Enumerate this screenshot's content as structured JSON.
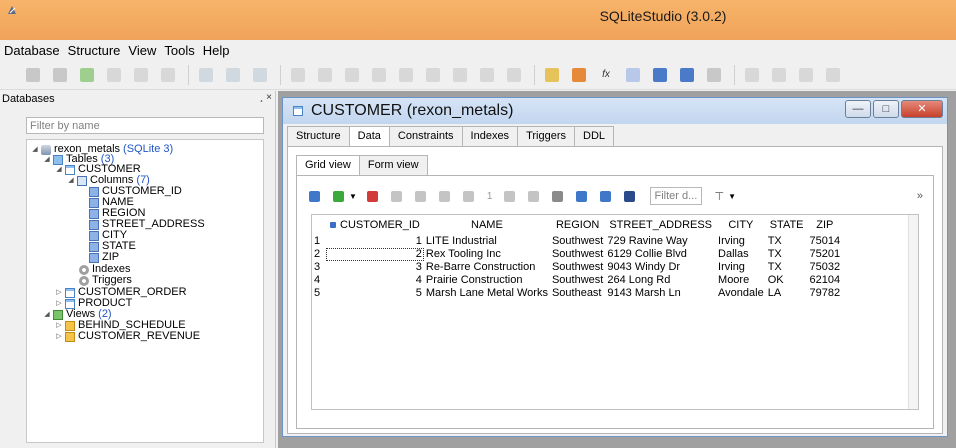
{
  "window": {
    "title": "SQLiteStudio (3.0.2)"
  },
  "menu": [
    "Database",
    "Structure",
    "View",
    "Tools",
    "Help"
  ],
  "dock": {
    "title": "Databases",
    "controls": "¸ ×",
    "filter_placeholder": "Filter by name"
  },
  "tree": {
    "db_name": "rexon_metals",
    "db_badge": "(SQLite 3)",
    "tables_label": "Tables",
    "tables_count": "(3)",
    "customer": "CUSTOMER",
    "columns_label": "Columns",
    "columns_count": "(7)",
    "columns": [
      "CUSTOMER_ID",
      "NAME",
      "REGION",
      "STREET_ADDRESS",
      "CITY",
      "STATE",
      "ZIP"
    ],
    "indexes": "Indexes",
    "triggers": "Triggers",
    "customer_order": "CUSTOMER_ORDER",
    "product": "PRODUCT",
    "views_label": "Views",
    "views_count": "(2)",
    "views": [
      "BEHIND_SCHEDULE",
      "CUSTOMER_REVENUE"
    ]
  },
  "editor": {
    "title": "CUSTOMER (rexon_metals)",
    "win_min": "—",
    "win_max": "□",
    "win_close": "✕",
    "tabs": [
      "Structure",
      "Data",
      "Constraints",
      "Indexes",
      "Triggers",
      "DDL"
    ],
    "active_tab": "Data",
    "view_tabs": [
      "Grid view",
      "Form view"
    ],
    "active_view": "Grid view",
    "page": "1",
    "filter_placeholder": "Filter d...",
    "more": "»"
  },
  "grid": {
    "headers": [
      "CUSTOMER_ID",
      "NAME",
      "REGION",
      "STREET_ADDRESS",
      "CITY",
      "STATE",
      "ZIP"
    ],
    "rows": [
      [
        "1",
        "1",
        "LITE Industrial",
        "Southwest",
        "729 Ravine Way",
        "Irving",
        "TX",
        "75014"
      ],
      [
        "2",
        "2",
        "Rex Tooling Inc",
        "Southwest",
        "6129 Collie Blvd",
        "Dallas",
        "TX",
        "75201"
      ],
      [
        "3",
        "3",
        "Re-Barre Construction",
        "Southwest",
        "9043 Windy Dr",
        "Irving",
        "TX",
        "75032"
      ],
      [
        "4",
        "4",
        "Prairie Construction",
        "Southwest",
        "264 Long Rd",
        "Moore",
        "OK",
        "62104"
      ],
      [
        "5",
        "5",
        "Marsh Lane Metal Works",
        "Southeast",
        "9143 Marsh Ln",
        "Avondale",
        "LA",
        "79782"
      ]
    ]
  },
  "colors": {
    "titlebar": "#f0a35a",
    "subwin_title": "#c8daf0",
    "close": "#c7412c"
  }
}
